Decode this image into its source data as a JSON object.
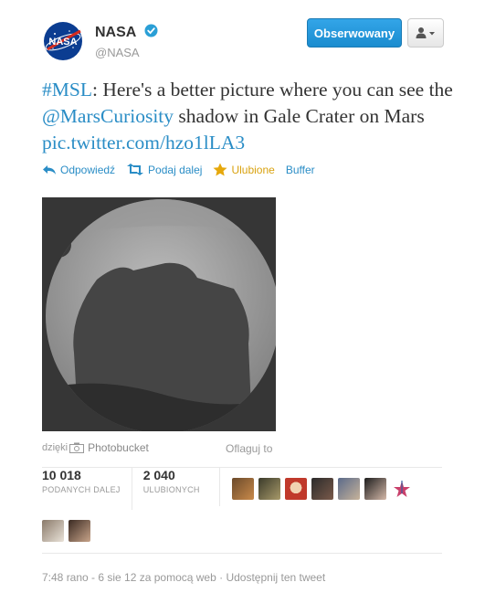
{
  "account": {
    "name": "NASA",
    "handle": "@NASA",
    "verified_icon": "verified-badge-icon"
  },
  "header": {
    "follow_label": "Obserwowany",
    "user_menu_icon": "user-dropdown-icon"
  },
  "tweet": {
    "hashtag": "#MSL",
    "part1": ": Here's a better picture where you can see the ",
    "mention": "@MarsCuriosity",
    "part2": " shadow in Gale Crater on Mars ",
    "pic_link": "pic.twitter.com/hzo1lLA3"
  },
  "actions": {
    "reply": "Odpowiedź",
    "retweet": "Podaj dalej",
    "favorite": "Ulubione",
    "buffer": "Buffer"
  },
  "media": {
    "credit_prefix": "dzięki",
    "credit_source": "Photobucket",
    "flag_label": "Oflaguj to"
  },
  "stats": {
    "retweets_count": "10 018",
    "retweets_label": "PODANYCH DALEJ",
    "favorites_count": "2 040",
    "favorites_label": "ULUBIONYCH"
  },
  "footer": {
    "text": "7:48 rano - 6 sie 12 za pomocą web · Udostępnij ten tweet"
  },
  "colors": {
    "link": "#2a8dc6",
    "follow_button": "#1a8ccf",
    "favorite": "#d9a20f"
  }
}
